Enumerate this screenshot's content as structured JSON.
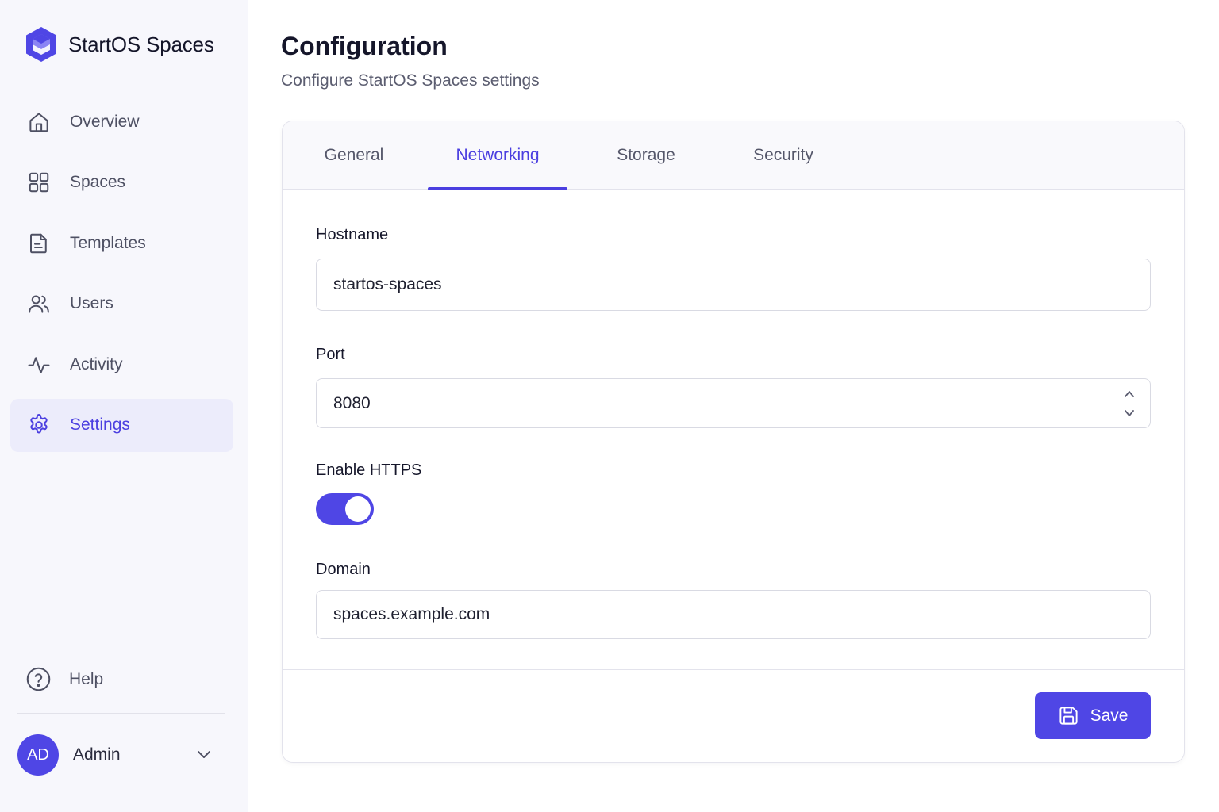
{
  "brand": {
    "name": "StartOS Spaces",
    "logo_icon": "hexagon-logo-icon"
  },
  "colors": {
    "accent": "#4f46e5",
    "accent_text": "#4b3fe0",
    "active_nav_bg": "#ececfb"
  },
  "sidebar": {
    "items": [
      {
        "label": "Overview",
        "icon": "home-icon",
        "active": false
      },
      {
        "label": "Spaces",
        "icon": "grid-icon",
        "active": false
      },
      {
        "label": "Templates",
        "icon": "document-icon",
        "active": false
      },
      {
        "label": "Users",
        "icon": "users-icon",
        "active": false
      },
      {
        "label": "Activity",
        "icon": "activity-icon",
        "active": false
      },
      {
        "label": "Settings",
        "icon": "gear-icon",
        "active": true
      }
    ],
    "help_label": "Help",
    "user": {
      "initials": "AD",
      "name": "Admin"
    }
  },
  "page": {
    "title": "Configuration",
    "subtitle": "Configure StartOS Spaces settings"
  },
  "tabs": [
    {
      "label": "General",
      "active": false
    },
    {
      "label": "Networking",
      "active": true
    },
    {
      "label": "Storage",
      "active": false
    },
    {
      "label": "Security",
      "active": false
    }
  ],
  "form": {
    "hostname": {
      "label": "Hostname",
      "value": "startos-spaces"
    },
    "port": {
      "label": "Port",
      "value": "8080"
    },
    "https": {
      "label": "Enable HTTPS",
      "enabled": true
    },
    "domain": {
      "label": "Domain",
      "value": "spaces.example.com"
    }
  },
  "actions": {
    "save_label": "Save"
  }
}
